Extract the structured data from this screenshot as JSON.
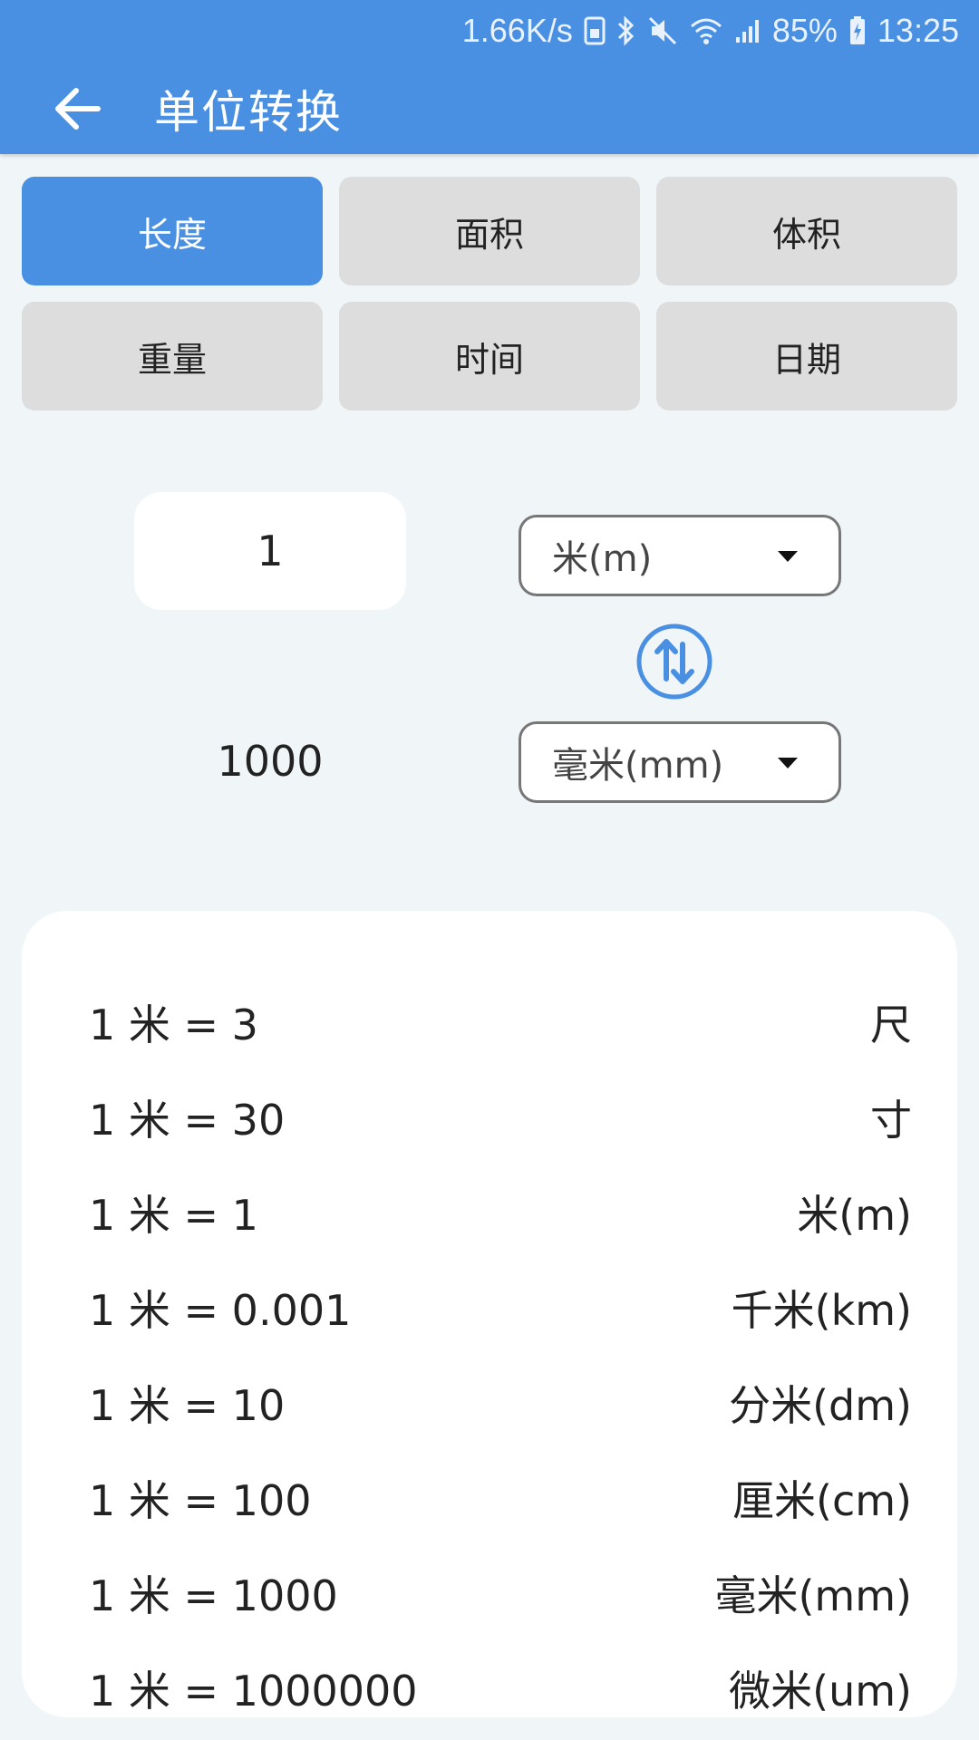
{
  "status_bar": {
    "speed": "1.66K/s",
    "battery": "85%",
    "time": "13:25"
  },
  "app_bar": {
    "title": "单位转换"
  },
  "tabs": [
    {
      "label": "长度",
      "active": true
    },
    {
      "label": "面积",
      "active": false
    },
    {
      "label": "体积",
      "active": false
    },
    {
      "label": "重量",
      "active": false
    },
    {
      "label": "时间",
      "active": false
    },
    {
      "label": "日期",
      "active": false
    }
  ],
  "converter": {
    "input_value": "1",
    "from_unit": "米(m)",
    "result_value": "1000",
    "to_unit": "毫米(mm)"
  },
  "conversions": [
    {
      "expr": "1 米 = 3",
      "unit": "尺"
    },
    {
      "expr": "1 米 = 30",
      "unit": "寸"
    },
    {
      "expr": "1 米 = 1",
      "unit": "米(m)"
    },
    {
      "expr": "1 米 = 0.001",
      "unit": "千米(km)"
    },
    {
      "expr": "1 米 = 10",
      "unit": "分米(dm)"
    },
    {
      "expr": "1 米 = 100",
      "unit": "厘米(cm)"
    },
    {
      "expr": "1 米 = 1000",
      "unit": "毫米(mm)"
    },
    {
      "expr": "1 米 = 1000000",
      "unit": "微米(um)"
    }
  ],
  "colors": {
    "primary": "#4a90e2",
    "background": "#f0f5f8",
    "tab_inactive": "#dddddd"
  },
  "icons": {
    "back": "arrow-left-icon",
    "swap": "swap-vertical-icon",
    "dropdown": "caret-down-icon"
  }
}
